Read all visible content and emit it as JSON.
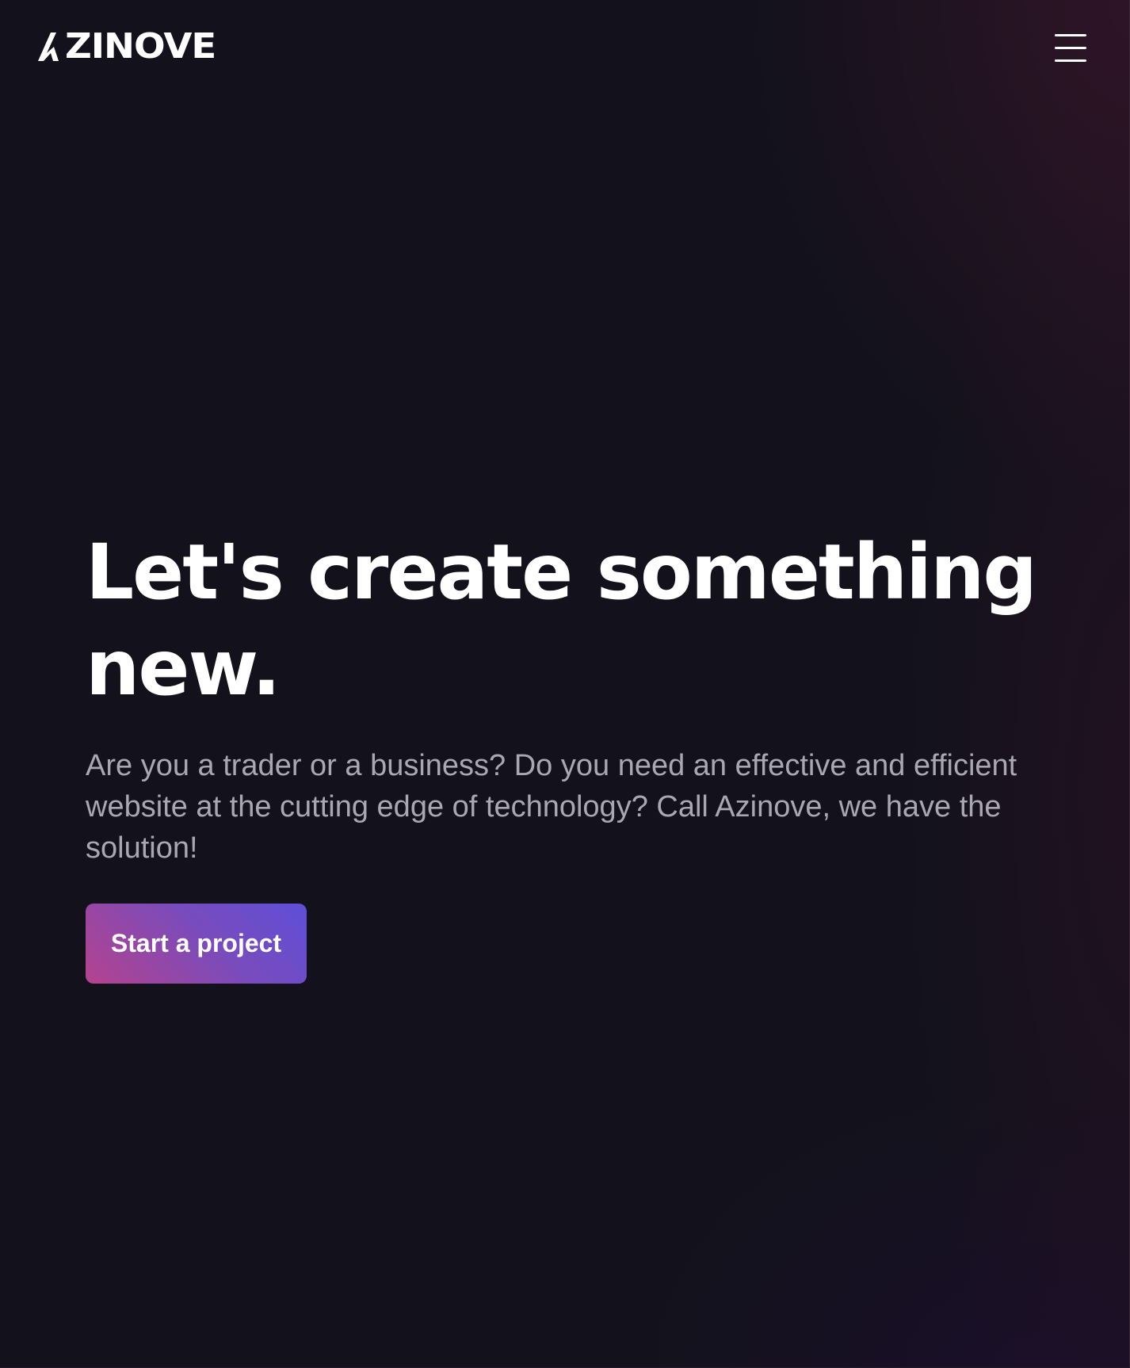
{
  "brand": {
    "name": "ZINOVE",
    "logo_icon": "azinove-a-mark-icon"
  },
  "header": {
    "menu_icon": "hamburger-menu-icon"
  },
  "hero": {
    "title": "Let's create something new.",
    "description": "Are you a trader or a business? Do you need an effective and efficient website at the cutting edge of technology? Call Azinove, we have the solution!",
    "cta_label": "Start a project"
  },
  "colors": {
    "background": "#13121c",
    "title_text": "#ffffff",
    "body_text": "#a9a7b3",
    "cta_gradient_start": "#b4438e",
    "cta_gradient_end": "#5d4fd8"
  }
}
